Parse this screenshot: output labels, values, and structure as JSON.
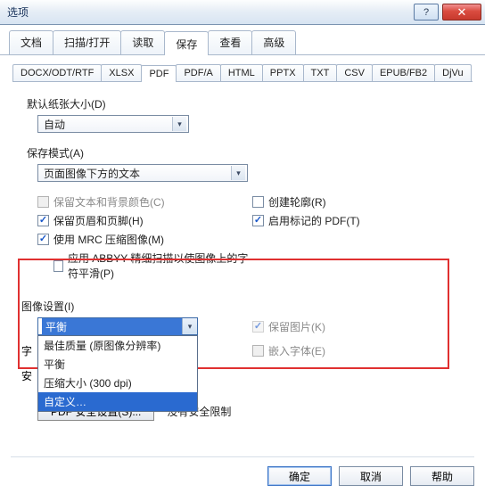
{
  "window": {
    "title": "选项"
  },
  "outer_tabs": {
    "t0": "文档",
    "t1": "扫描/打开",
    "t2": "读取",
    "t3": "保存",
    "t4": "查看",
    "t5": "高级",
    "active": "保存"
  },
  "inner_tabs": {
    "t0": "DOCX/ODT/RTF",
    "t1": "XLSX",
    "t2": "PDF",
    "t3": "PDF/A",
    "t4": "HTML",
    "t5": "PPTX",
    "t6": "TXT",
    "t7": "CSV",
    "t8": "EPUB/FB2",
    "t9": "DjVu",
    "active": "PDF"
  },
  "paper": {
    "label": "默认纸张大小(D)",
    "value": "自动"
  },
  "save_mode": {
    "label": "保存模式(A)",
    "value": "页面图像下方的文本"
  },
  "checks": {
    "keep_text_bg": "保留文本和背景颜色(C)",
    "keep_header_footer": "保留页眉和页脚(H)",
    "use_mrc": "使用 MRC 压缩图像(M)",
    "abbyy_precise": "应用 ABBYY 精细扫描以使图像上的字符平滑(P)",
    "create_outline": "创建轮廓(R)",
    "tagged_pdf": "启用标记的 PDF(T)",
    "keep_pictures": "保留图片(K)",
    "embed_fonts": "嵌入字体(E)"
  },
  "groups": {
    "image_settings": "图像设置(I)",
    "font": "字",
    "security": "安"
  },
  "dropdown": {
    "selected": "平衡",
    "opt0": "最佳质量 (原图像分辨率)",
    "opt1": "平衡",
    "opt2": "压缩大小 (300 dpi)",
    "opt3": "自定义…"
  },
  "security": {
    "button": "PDF 安全设置(S)...",
    "status": "没有安全限制"
  },
  "footer": {
    "ok": "确定",
    "cancel": "取消",
    "help": "帮助"
  }
}
